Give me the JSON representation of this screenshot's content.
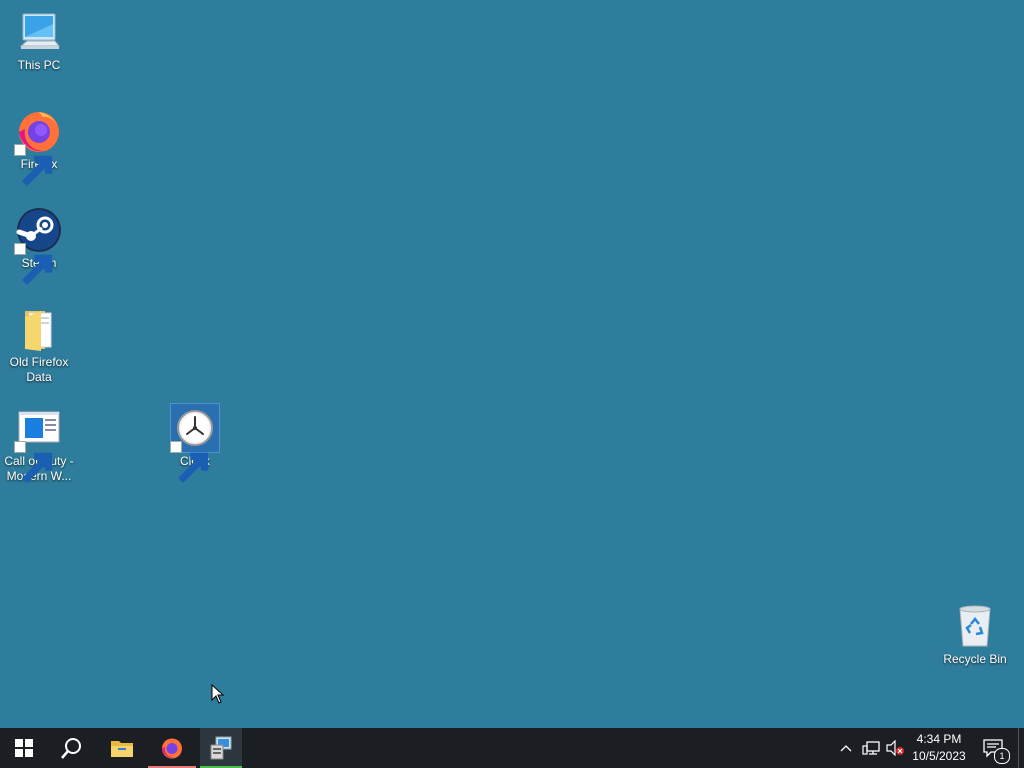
{
  "desktop": {
    "icons": [
      {
        "label": "This PC"
      },
      {
        "label": "Firefox"
      },
      {
        "label": "Steam"
      },
      {
        "label": "Old Firefox Data"
      },
      {
        "label": "Call of Duty - Modern W..."
      },
      {
        "label": "Clock"
      },
      {
        "label": "Recycle Bin"
      }
    ]
  },
  "taskbar": {
    "clock": {
      "time": "4:34 PM",
      "date": "10/5/2023"
    },
    "notifications_count": "1",
    "colors": {
      "firefox_indicator": "#e67c73",
      "explorer_indicator": "#4cc24c"
    }
  }
}
